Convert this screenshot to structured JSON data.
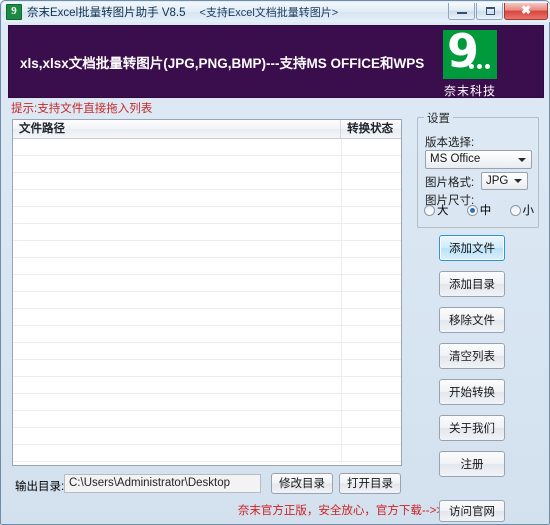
{
  "window": {
    "title": "奈末Excel批量转图片助手 V8.5",
    "subtitle": "<支持Excel文档批量转图片>",
    "app_icon": "app-logo-icon",
    "controls": {
      "minimize": "minimize-icon",
      "maximize": "maximize-icon",
      "close": "✖"
    }
  },
  "banner": {
    "headline": "xls,xlsx文档批量转图片(JPG,PNG,BMP)---支持MS OFFICE和WPS",
    "logo_digit": "9",
    "logo_caption": "奈末科技",
    "bg_color": "#3a0d4c",
    "logo_color": "#009a3d"
  },
  "hint": {
    "text": "提示:支持文件直接拖入列表",
    "color": "#c62828"
  },
  "list": {
    "columns": [
      "文件路径",
      "转换状态"
    ],
    "rows": []
  },
  "settings": {
    "legend": "设置",
    "version_label": "版本选择:",
    "version_value": "MS Office",
    "format_label": "图片格式:",
    "format_value": "JPG",
    "size_label": "图片尺寸:",
    "size_options": [
      {
        "label": "大",
        "checked": false
      },
      {
        "label": "中",
        "checked": true
      },
      {
        "label": "小",
        "checked": false
      }
    ]
  },
  "actions": [
    {
      "label": "添加文件",
      "focused": true
    },
    {
      "label": "添加目录",
      "focused": false
    },
    {
      "label": "移除文件",
      "focused": false
    },
    {
      "label": "清空列表",
      "focused": false
    },
    {
      "label": "开始转换",
      "focused": false
    },
    {
      "label": "关于我们",
      "focused": false
    },
    {
      "label": "注册",
      "focused": false
    }
  ],
  "output": {
    "label": "输出目录:",
    "path": "C:\\Users\\Administrator\\Desktop",
    "modify_button": "修改目录",
    "open_button": "打开目录"
  },
  "footer": {
    "promo": "奈末官方正版，安全放心，官方下载-->>",
    "promo_color": "#cc2222",
    "official_button": "访问官网"
  }
}
